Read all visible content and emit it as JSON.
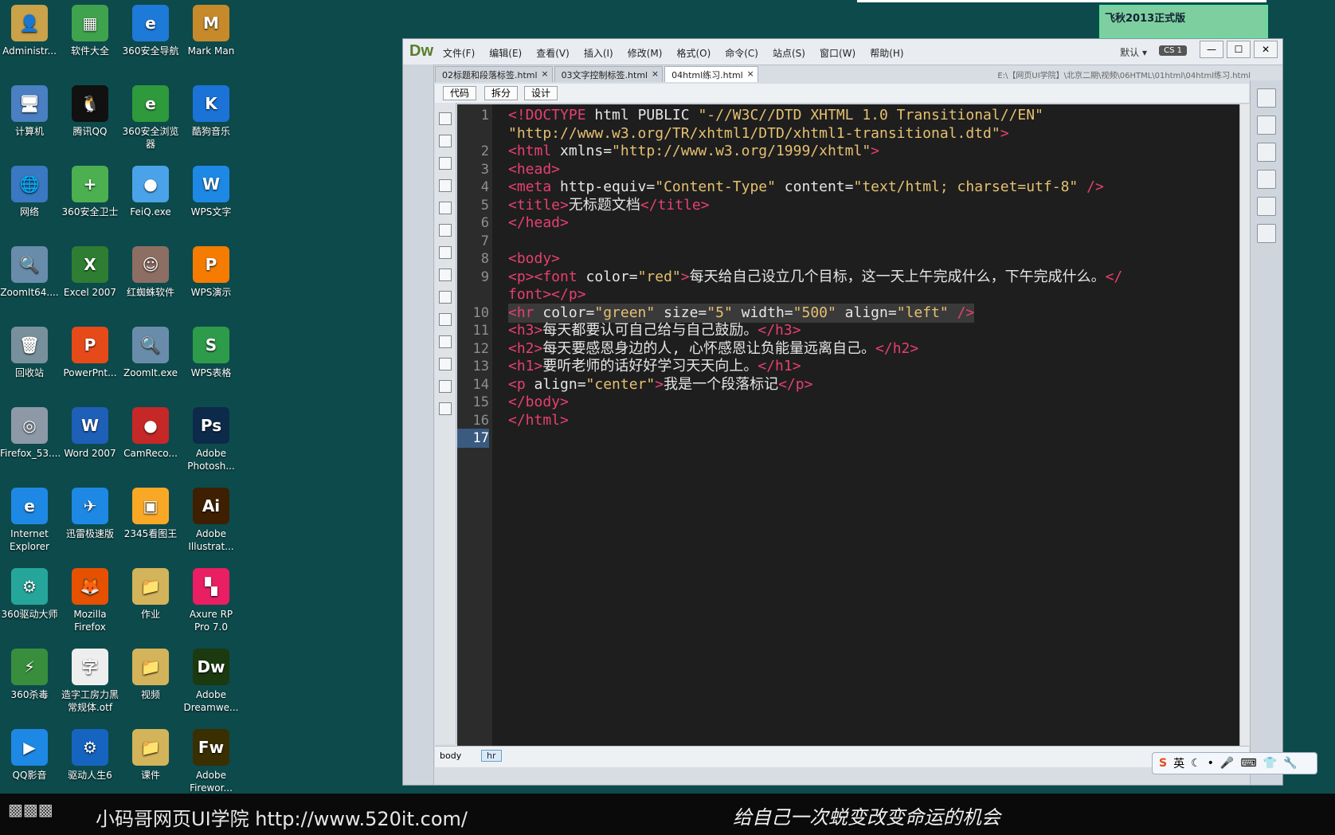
{
  "desktop": {
    "icons": [
      {
        "label": "Administr...",
        "col": 0,
        "row": 0,
        "color": "#c9a24a",
        "glyph": "👤"
      },
      {
        "label": "软件大全",
        "col": 1,
        "row": 0,
        "color": "#3fa34d",
        "glyph": "▦"
      },
      {
        "label": "360安全导航",
        "col": 2,
        "row": 0,
        "color": "#1e7ad8",
        "glyph": "e"
      },
      {
        "label": "Mark Man",
        "col": 3,
        "row": 0,
        "color": "#c78a2a",
        "glyph": "M"
      },
      {
        "label": "计算机",
        "col": 0,
        "row": 1,
        "color": "#4a7fc1",
        "glyph": "🖥"
      },
      {
        "label": "腾讯QQ",
        "col": 1,
        "row": 1,
        "color": "#111",
        "glyph": "🐧"
      },
      {
        "label": "360安全浏览器",
        "col": 2,
        "row": 1,
        "color": "#2e9a3b",
        "glyph": "e"
      },
      {
        "label": "酷狗音乐",
        "col": 3,
        "row": 1,
        "color": "#1b73d8",
        "glyph": "K"
      },
      {
        "label": "网络",
        "col": 0,
        "row": 2,
        "color": "#3a78c2",
        "glyph": "🌐"
      },
      {
        "label": "360安全卫士",
        "col": 1,
        "row": 2,
        "color": "#4caf50",
        "glyph": "+"
      },
      {
        "label": "FeiQ.exe",
        "col": 2,
        "row": 2,
        "color": "#4aa3e8",
        "glyph": "●"
      },
      {
        "label": "WPS文字",
        "col": 3,
        "row": 2,
        "color": "#1e88e5",
        "glyph": "W"
      },
      {
        "label": "ZoomIt64....",
        "col": 0,
        "row": 3,
        "color": "#6a8cab",
        "glyph": "🔍"
      },
      {
        "label": "Excel 2007",
        "col": 1,
        "row": 3,
        "color": "#2e7d32",
        "glyph": "X"
      },
      {
        "label": "红蜘蛛软件",
        "col": 2,
        "row": 3,
        "color": "#8d6e63",
        "glyph": "☺"
      },
      {
        "label": "WPS演示",
        "col": 3,
        "row": 3,
        "color": "#f57c00",
        "glyph": "P"
      },
      {
        "label": "回收站",
        "col": 0,
        "row": 4,
        "color": "#78909c",
        "glyph": "🗑"
      },
      {
        "label": "PowerPnt...",
        "col": 1,
        "row": 4,
        "color": "#e64a19",
        "glyph": "P"
      },
      {
        "label": "ZoomIt.exe",
        "col": 2,
        "row": 4,
        "color": "#6a8cab",
        "glyph": "🔍"
      },
      {
        "label": "WPS表格",
        "col": 3,
        "row": 4,
        "color": "#2e9b4a",
        "glyph": "S"
      },
      {
        "label": "Firefox_53....",
        "col": 0,
        "row": 5,
        "color": "#8e99a8",
        "glyph": "◎"
      },
      {
        "label": "Word 2007",
        "col": 1,
        "row": 5,
        "color": "#1e5fb8",
        "glyph": "W"
      },
      {
        "label": "CamReco...",
        "col": 2,
        "row": 5,
        "color": "#c62828",
        "glyph": "●"
      },
      {
        "label": "Adobe Photosh...",
        "col": 3,
        "row": 5,
        "color": "#0d2a4a",
        "glyph": "Ps"
      },
      {
        "label": "Internet Explorer",
        "col": 0,
        "row": 6,
        "color": "#1e88e5",
        "glyph": "e"
      },
      {
        "label": "迅雷极速版",
        "col": 1,
        "row": 6,
        "color": "#1e88e5",
        "glyph": "✈"
      },
      {
        "label": "2345看图王",
        "col": 2,
        "row": 6,
        "color": "#f9a825",
        "glyph": "▣"
      },
      {
        "label": "Adobe Illustrat...",
        "col": 3,
        "row": 6,
        "color": "#3e1f00",
        "glyph": "Ai"
      },
      {
        "label": "360驱动大师",
        "col": 0,
        "row": 7,
        "color": "#26a69a",
        "glyph": "⚙"
      },
      {
        "label": "Mozilla Firefox",
        "col": 1,
        "row": 7,
        "color": "#e65100",
        "glyph": "🦊"
      },
      {
        "label": "作业",
        "col": 2,
        "row": 7,
        "color": "#d4b45a",
        "glyph": "📁"
      },
      {
        "label": "Axure RP Pro 7.0",
        "col": 3,
        "row": 7,
        "color": "#e91e63",
        "glyph": "▚"
      },
      {
        "label": "360杀毒",
        "col": 0,
        "row": 8,
        "color": "#388e3c",
        "glyph": "⚡"
      },
      {
        "label": "造字工房力黑常规体.otf",
        "col": 1,
        "row": 8,
        "color": "#eeeeee",
        "glyph": "字"
      },
      {
        "label": "视频",
        "col": 2,
        "row": 8,
        "color": "#d4b45a",
        "glyph": "📁"
      },
      {
        "label": "Adobe Dreamwe...",
        "col": 3,
        "row": 8,
        "color": "#1b3a0f",
        "glyph": "Dw"
      },
      {
        "label": "QQ影音",
        "col": 0,
        "row": 9,
        "color": "#1e88e5",
        "glyph": "▶"
      },
      {
        "label": "驱动人生6",
        "col": 1,
        "row": 9,
        "color": "#1565c0",
        "glyph": "⚙"
      },
      {
        "label": "课件",
        "col": 2,
        "row": 9,
        "color": "#d4b45a",
        "glyph": "📁"
      },
      {
        "label": "Adobe Firewor...",
        "col": 3,
        "row": 9,
        "color": "#3a2f00",
        "glyph": "Fw"
      }
    ]
  },
  "dw": {
    "logo": "Dw",
    "menus": [
      "文件(F)",
      "编辑(E)",
      "查看(V)",
      "插入(I)",
      "修改(M)",
      "格式(O)",
      "命令(C)",
      "站点(S)",
      "窗口(W)",
      "帮助(H)"
    ],
    "preset": "默认 ▾",
    "badge": "CS 1",
    "win_buttons": [
      "—",
      "☐",
      "✕"
    ],
    "tabs": [
      {
        "label": "02标题和段落标签.html",
        "active": false
      },
      {
        "label": "03文字控制标签.html",
        "active": false
      },
      {
        "label": "04html练习.html",
        "active": true
      }
    ],
    "path": "E:\\【网页UI学院】\\北京二期\\视频\\06HTML\\01html\\04html练习.html",
    "views": [
      "代码",
      "拆分",
      "设计"
    ],
    "status_tag": "body",
    "status_tag2": "hr",
    "code_lines": [
      {
        "n": "1",
        "html": "<span class=\"tag\">&lt;!DOCTYPE</span> html PUBLIC <span class=\"str\">\"-//W3C//DTD XHTML 1.0 Transitional//EN\"</span>"
      },
      {
        "n": "",
        "html": "<span class=\"str\">\"http://www.w3.org/TR/xhtml1/DTD/xhtml1-transitional.dtd\"</span><span class=\"tag\">&gt;</span>"
      },
      {
        "n": "2",
        "html": "<span class=\"tag\">&lt;html</span> xmlns=<span class=\"str\">\"http://www.w3.org/1999/xhtml\"</span><span class=\"tag\">&gt;</span>"
      },
      {
        "n": "3",
        "html": "<span class=\"tag\">&lt;head&gt;</span>"
      },
      {
        "n": "4",
        "html": "<span class=\"tag\">&lt;meta</span> http-equiv=<span class=\"str\">\"Content-Type\"</span> content=<span class=\"str\">\"text/html; charset=utf-8\"</span> <span class=\"tag\">/&gt;</span>"
      },
      {
        "n": "5",
        "html": "<span class=\"tag\">&lt;title&gt;</span>无标题文档<span class=\"tag\">&lt;/title&gt;</span>"
      },
      {
        "n": "6",
        "html": "<span class=\"tag\">&lt;/head&gt;</span>"
      },
      {
        "n": "7",
        "html": ""
      },
      {
        "n": "8",
        "html": "<span class=\"tag\">&lt;body&gt;</span>"
      },
      {
        "n": "9",
        "html": "<span class=\"tag\">&lt;p&gt;&lt;font</span> color=<span class=\"str\">\"red\"</span><span class=\"tag\">&gt;</span>每天给自己设立几个目标，这一天上午完成什么，下午完成什么。<span class=\"tag\">&lt;/</span>"
      },
      {
        "n": "",
        "html": "<span class=\"tag\">font&gt;&lt;/p&gt;</span>"
      },
      {
        "n": "10",
        "hl": true,
        "html": "<span class=\"tag\">&lt;hr</span> color=<span class=\"str\">\"green\"</span> size=<span class=\"str\">\"5\"</span> width=<span class=\"str\">\"500\"</span> align=<span class=\"str\">\"left\"</span> <span class=\"tag\">/&gt;</span>"
      },
      {
        "n": "11",
        "html": "<span class=\"tag\">&lt;h3&gt;</span>每天都要认可自己给与自己鼓励。<span class=\"tag\">&lt;/h3&gt;</span>"
      },
      {
        "n": "12",
        "html": "<span class=\"tag\">&lt;h2&gt;</span>每天要感恩身边的人, 心怀感恩让负能量远离自己。<span class=\"tag\">&lt;/h2&gt;</span>"
      },
      {
        "n": "13",
        "html": "<span class=\"tag\">&lt;h1&gt;</span>要听老师的话好好学习天天向上。<span class=\"tag\">&lt;/h1&gt;</span>"
      },
      {
        "n": "14",
        "html": "<span class=\"tag\">&lt;p</span> align=<span class=\"str\">\"center\"</span><span class=\"tag\">&gt;</span>我是一个段落标记<span class=\"tag\">&lt;/p&gt;</span>"
      },
      {
        "n": "15",
        "html": "<span class=\"tag\">&lt;/body&gt;</span>"
      },
      {
        "n": "16",
        "html": "<span class=\"tag\">&lt;/html&gt;</span>"
      },
      {
        "n": "17",
        "cur": true,
        "html": ""
      }
    ]
  },
  "float_panel": {
    "title": "飞秋2013正式版"
  },
  "ime": {
    "label": "英"
  },
  "banner": {
    "brand": "小码哥网页UI学院  http://www.520it.com/",
    "slogan": "给自己一次蜕变改变命运的机会"
  },
  "colors": {
    "desktop": "#0d4a4c",
    "tag": "#e64070",
    "string": "#e6c070"
  }
}
